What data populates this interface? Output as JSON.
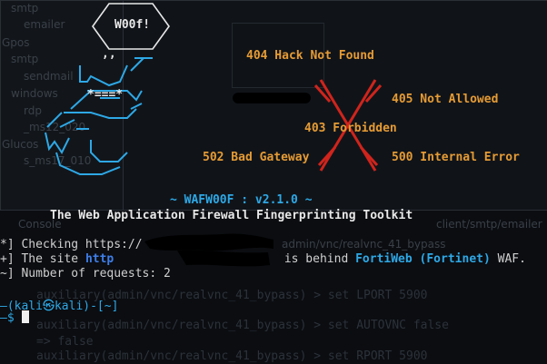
{
  "background": {
    "sidebar_items": [
      "smtp",
      "emailer",
      "Gpos",
      "smtp",
      "sendmail",
      "windows",
      "rdp",
      "_ms12_020",
      "Glucos",
      "s_ms17_010",
      "Console"
    ],
    "tabs": [
      "client/smtp/emailer",
      "admin/vnc/realvnc_41_bypass"
    ],
    "msf_lines": [
      "auxiliary(admin/vnc/realvnc_41_bypass) > set LPORT 5900",
      "auxiliary(admin/vnc/realvnc_41_bypass) > set AUTOVNC false",
      "=> false",
      "auxiliary(admin/vnc/realvnc_41_bypass) > set RPORT 5900"
    ]
  },
  "banner": {
    "woof_label": "W00f!",
    "codes": {
      "c404": "404 Hack Not Found",
      "c405": "405 Not Allowed",
      "c403": "403 Forbidden",
      "c502": "502 Bad Gateway",
      "c500": "500 Internal Error"
    },
    "version_line": "~ WAFW00F : v2.1.0 ~",
    "subtitle": "The Web Application Firewall Fingerprinting Toolkit"
  },
  "output": {
    "line1_prefix": "*]",
    "line1_text": " Checking https://",
    "line2_prefix": "+]",
    "line2_text": " The site ",
    "line2_url": "http",
    "line2_mid": " is behind ",
    "line2_waf": "FortiWeb (Fortinet)",
    "line2_end": " WAF.",
    "line3_prefix": "~]",
    "line3_text": " Number of requests: 2"
  },
  "prompt": {
    "line1": "—(kali㉿kali)-[~]",
    "line2": "—$ "
  },
  "colors": {
    "orange": "#e69b34",
    "cyan": "#2ea8e6",
    "red": "#d0241c",
    "blue": "#3e7ee8",
    "terminal_bg": "#0b0d11"
  }
}
